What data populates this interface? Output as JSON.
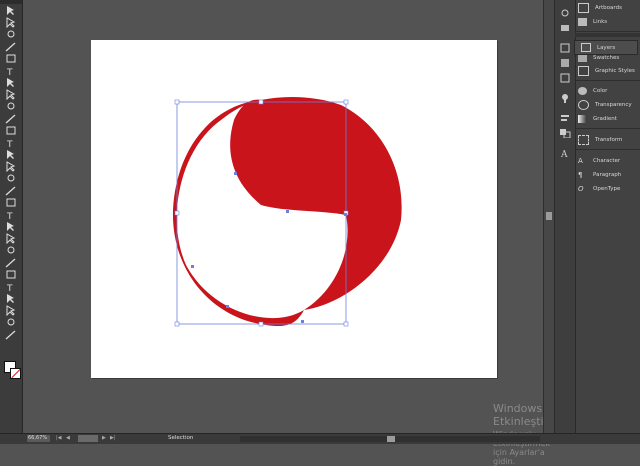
{
  "tools": [
    "selection-tool",
    "direct-selection-tool",
    "magic-wand-tool",
    "lasso-tool",
    "pen-tool",
    "type-tool",
    "line-tool",
    "rectangle-tool",
    "paintbrush-tool",
    "pencil-tool",
    "blob-brush-tool",
    "eraser-tool",
    "rotate-tool",
    "scale-tool",
    "width-tool",
    "free-transform-tool",
    "shape-builder-tool",
    "perspective-grid-tool",
    "mesh-tool",
    "gradient-tool",
    "eyedropper-tool",
    "blend-tool",
    "symbol-sprayer-tool",
    "column-graph-tool",
    "artboard-tool",
    "slice-tool",
    "hand-tool",
    "zoom-tool"
  ],
  "panels": {
    "artboards": "Artboards",
    "links": "Links",
    "layers": "Layers",
    "swatches": "Swatches",
    "graphic_styles": "Graphic Styles",
    "color": "Color",
    "transparency": "Transparency",
    "gradient": "Gradient",
    "transform": "Transform",
    "character": "Character",
    "paragraph": "Paragraph",
    "opentype": "OpenType"
  },
  "status": {
    "zoom": "66,67%",
    "tool_name": "Selection"
  },
  "watermark": {
    "title": "Windows'u Etkinleştir",
    "subtitle": "Windows'u etkinleştirmek için Ayarlar'a gidin."
  },
  "colors": {
    "shape_fill": "#c8141a",
    "selection": "#6c7fe0"
  }
}
